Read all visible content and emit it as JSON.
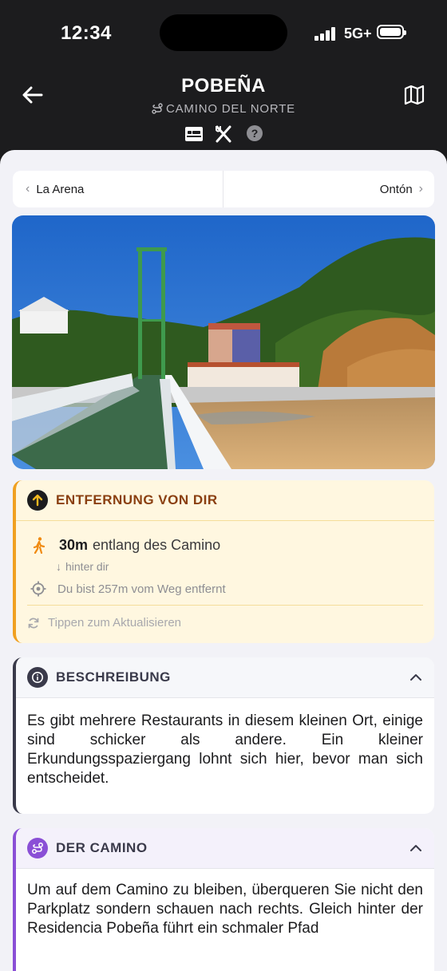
{
  "status": {
    "time": "12:34",
    "network": "5G+"
  },
  "header": {
    "title": "POBEÑA",
    "subtitle": "CAMINO DEL NORTE"
  },
  "nav": {
    "prev": "La Arena",
    "next": "Ontón"
  },
  "photo": {
    "alt": ""
  },
  "distance": {
    "title": "ENTFERNUNG VON DIR",
    "amount": "30m",
    "along": "entlang des Camino",
    "behind": "hinter dir",
    "off_route": "Du bist 257m vom Weg entfernt",
    "refresh": "Tippen zum Aktualisieren"
  },
  "description": {
    "title": "BESCHREIBUNG",
    "text": "Es gibt mehrere Restaurants in diesem kleinen Ort, einige sind schicker als andere. Ein kleiner Erkundungsspaziergang lohnt sich hier, bevor man sich entscheidet."
  },
  "camino": {
    "title": "DER CAMINO",
    "text": "Um auf dem Camino zu bleiben, überqueren Sie nicht den Parkplatz sondern schauen nach rechts. Gleich hinter der Residencia Pobeña führt ein schmaler Pfad"
  },
  "colors": {
    "distance_accent": "#f0a020",
    "distance_title": "#8a3f10",
    "description_accent": "#3a3a4a",
    "camino_accent": "#8a4fd6"
  },
  "icons": [
    "back-arrow-icon",
    "map-icon",
    "route-icon",
    "bed-icon",
    "restaurant-icon",
    "help-icon",
    "up-arrow-icon",
    "walk-icon",
    "crosshair-icon",
    "refresh-icon",
    "info-icon",
    "chevron-up-icon"
  ]
}
